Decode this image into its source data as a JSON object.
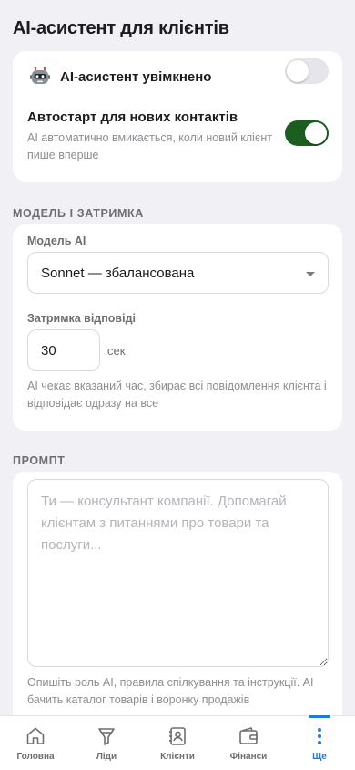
{
  "page": {
    "title": "AI-асистент для клієнтів"
  },
  "assistant": {
    "label": "AI-асистент увімкнено",
    "enabled": false,
    "autostart_title": "Автостарт для нових контактів",
    "autostart_desc": "AI автоматично вмикається, коли новий клієнт пише вперше",
    "autostart_enabled": true,
    "icon": "robot-icon"
  },
  "model_section": {
    "title": "МОДЕЛЬ І ЗАТРИМКА",
    "model_label": "Модель AI",
    "model_value": "Sonnet — збалансована",
    "delay_label": "Затримка відповіді",
    "delay_value": "30",
    "delay_unit": "сек",
    "delay_desc": "AI чекає вказаний час, збирає всі повідомлення клієнта і відповідає одразу на все"
  },
  "prompt_section": {
    "title": "ПРОМПТ",
    "placeholder": "Ти — консультант компанії. Допомагай клієнтам з питаннями про товари та послуги...",
    "value": "",
    "desc": "Опишіть роль AI, правила спілкування та інструкції. AI бачить каталог товарів і воронку продажів"
  },
  "tabs": [
    {
      "label": "Головна",
      "icon": "home-icon"
    },
    {
      "label": "Ліди",
      "icon": "funnel-icon"
    },
    {
      "label": "Клієнти",
      "icon": "contacts-icon"
    },
    {
      "label": "Фінанси",
      "icon": "wallet-icon"
    },
    {
      "label": "Ще",
      "icon": "more-icon",
      "active": true
    }
  ],
  "colors": {
    "accent": "#1e7ae0",
    "toggle_on": "#1b5e20",
    "background": "#f0f0f5"
  }
}
